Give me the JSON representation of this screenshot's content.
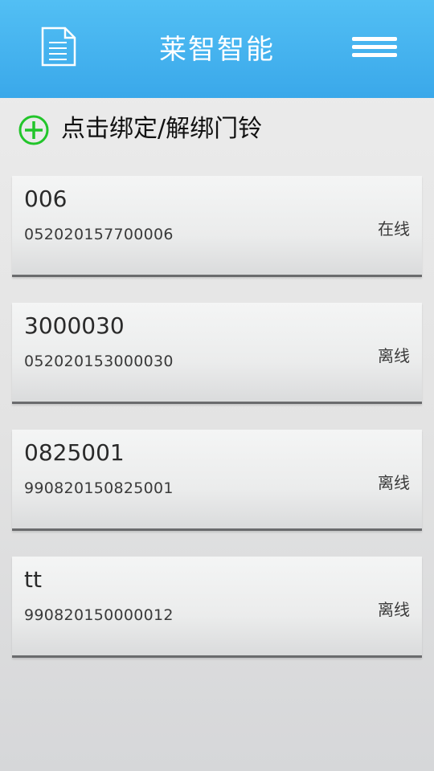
{
  "header": {
    "title": "莱智智能",
    "left_icon": "document-icon",
    "right_icon": "menu-icon"
  },
  "bind": {
    "label": "点击绑定/解绑门铃",
    "icon": "add-circle-icon",
    "icon_color": "#22c52a"
  },
  "devices": [
    {
      "name": "006",
      "id": "052020157700006",
      "status": "在线"
    },
    {
      "name": "3000030",
      "id": "052020153000030",
      "status": "离线"
    },
    {
      "name": "0825001",
      "id": "990820150825001",
      "status": "离线"
    },
    {
      "name": "tt",
      "id": "990820150000012",
      "status": "离线"
    }
  ],
  "colors": {
    "header_top": "#52bff4",
    "header_bottom": "#3aa8ea",
    "background": "#e3e3e3"
  }
}
